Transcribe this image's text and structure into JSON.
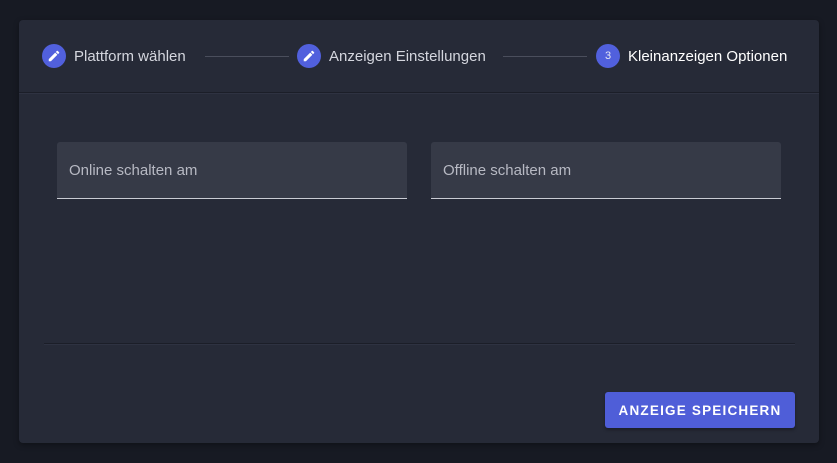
{
  "stepper": {
    "steps": [
      {
        "label": "Plattform wählen",
        "state": "done",
        "icon": "pencil-icon"
      },
      {
        "label": "Anzeigen Einstellungen",
        "state": "done",
        "icon": "pencil-icon"
      },
      {
        "label": "Kleinanzeigen Optionen",
        "state": "active",
        "number": "3"
      }
    ]
  },
  "form": {
    "online_placeholder": "Online schalten am",
    "offline_placeholder": "Offline schalten am"
  },
  "actions": {
    "save_label": "ANZEIGE SPEICHERN"
  },
  "colors": {
    "background": "#171a23",
    "card": "#262a37",
    "field": "#363a47",
    "accent": "#4f5ed8"
  }
}
